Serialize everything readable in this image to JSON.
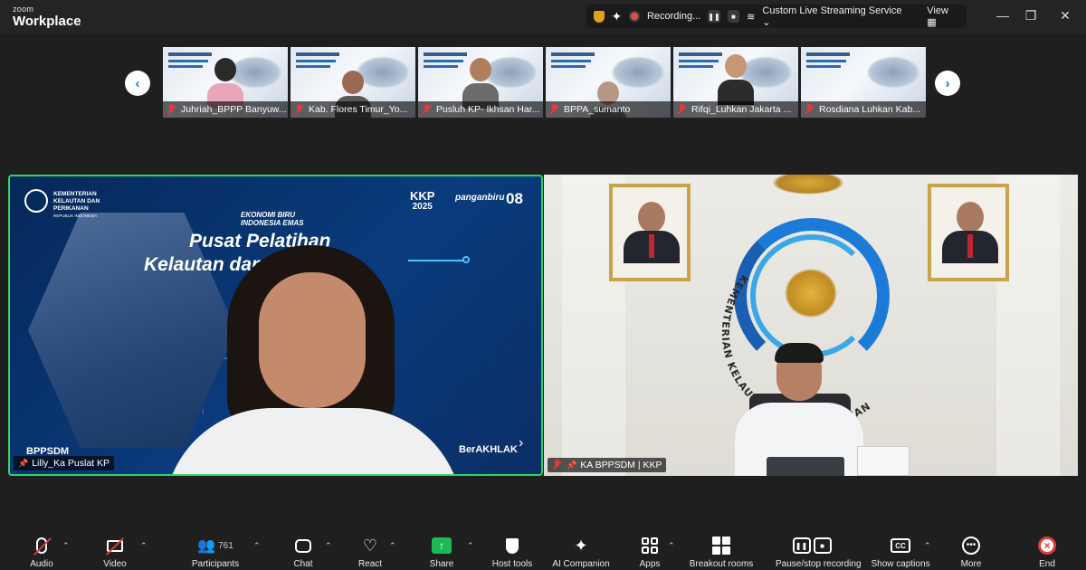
{
  "app": {
    "brand_top": "zoom",
    "brand_main": "Workplace"
  },
  "status_bar": {
    "recording_label": "Recording...",
    "streaming_label": "Custom Live Streaming Service",
    "view_label": "View"
  },
  "gallery": {
    "participants": [
      "Juhriah_BPPP Banyuw...",
      "Kab. Flores Timur_Yo...",
      "Pusluh KP- Ikhsan Har...",
      "BPPA_sumanto",
      "Rifqi_Luhkan Jakarta ...",
      "Rosdiana Luhkan Kab..."
    ]
  },
  "main_tiles": {
    "left": {
      "name": "Lilly_Ka Puslat KP",
      "slide": {
        "org_line1": "KEMENTERIAN",
        "org_line2": "KELAUTAN DAN",
        "org_line3": "PERIKANAN",
        "org_line4": "REPUBLIK INDONESIA",
        "ekonomi_line1": "EKONOMI BIRU",
        "ekonomi_line2": "INDONESIA EMAS",
        "title_line1": "Pusat Pelatihan",
        "title_line2": "Kelautan dan Perikanan",
        "logo_kkp_top": "KKP",
        "logo_kkp_bottom": "2025",
        "logo_panganbiru": "panganbiru",
        "logo_08": "08",
        "footer_left": "BPPSDM",
        "footer_right": "BerAKHLAK"
      }
    },
    "right": {
      "name": "KA BPPSDM | KKP",
      "emblem_text": "KEMENTERIAN KELAUTAN DAN PERIKANAN"
    }
  },
  "toolbar": {
    "audio": "Audio",
    "video": "Video",
    "participants": "Participants",
    "participants_count": "761",
    "chat": "Chat",
    "react": "React",
    "share": "Share",
    "host_tools": "Host tools",
    "ai_companion": "AI Companion",
    "apps": "Apps",
    "breakout_rooms": "Breakout rooms",
    "pause_stop_recording": "Pause/stop recording",
    "show_captions": "Show captions",
    "more": "More",
    "end": "End"
  },
  "colors": {
    "active_speaker_border": "#2fd36a",
    "share_green": "#1db954",
    "mute_red": "#e03b3b",
    "nav_blue": "#1e6fd9"
  }
}
